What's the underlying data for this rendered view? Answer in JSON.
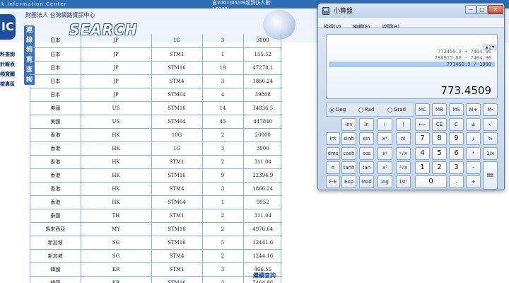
{
  "web": {
    "site_name": "k Information Center",
    "visit_text_1": "自2001/05/09起到訪人數:",
    "visit_text_2": "15941",
    "logo_text": "IC",
    "org_name": "財團法人 台灣網路資訊中心",
    "banner_cn": "連線頻寬查詢",
    "banner_en": "SEARCH",
    "left_nav": [
      "料查詢",
      "計報表",
      "頻寬圖",
      "檢專區"
    ],
    "continue_link": "繼續查詢",
    "table_rows": [
      [
        "日本",
        "JP",
        "1G",
        "3",
        "3000"
      ],
      [
        "日本",
        "JP",
        "STM1",
        "1",
        "155.52"
      ],
      [
        "日本",
        "JP",
        "STM16",
        "19",
        "47278.1"
      ],
      [
        "日本",
        "JP",
        "STM4",
        "3",
        "1866.24"
      ],
      [
        "日本",
        "JP",
        "STM64",
        "4",
        "39808"
      ],
      [
        "美國",
        "US",
        "STM16",
        "14",
        "34836.5"
      ],
      [
        "美國",
        "US",
        "STM64",
        "45",
        "447840"
      ],
      [
        "香港",
        "HK",
        "10G",
        "2",
        "20000"
      ],
      [
        "香港",
        "HK",
        "1G",
        "3",
        "3000"
      ],
      [
        "香港",
        "HK",
        "STM1",
        "2",
        "311.04"
      ],
      [
        "香港",
        "HK",
        "STM16",
        "9",
        "22394.9"
      ],
      [
        "香港",
        "HK",
        "STM4",
        "3",
        "1866.24"
      ],
      [
        "香港",
        "HK",
        "STM64",
        "1",
        "9952"
      ],
      [
        "泰國",
        "TH",
        "STM1",
        "2",
        "311.04"
      ],
      [
        "馬來西亞",
        "MY",
        "STM16",
        "2",
        "4976.64"
      ],
      [
        "新加坡",
        "SG",
        "STM16",
        "5",
        "12441.6"
      ],
      [
        "新加坡",
        "SG",
        "STM4",
        "2",
        "1244.16"
      ],
      [
        "韓國",
        "KR",
        "STM1",
        "3",
        "466.56"
      ],
      [
        "韓國",
        "KR",
        "STM16",
        "3",
        "7464.96"
      ]
    ]
  },
  "calculator": {
    "title": "小算盤",
    "window_buttons": {
      "minimize": "─",
      "maximize": "□",
      "close": "✕"
    },
    "menu": [
      "檢視(V)",
      "編輯(E)",
      "說明(H)"
    ],
    "history_scroll": {
      "up": "▲",
      "down": "▼"
    },
    "history": [
      "773450.9 + 7464.96",
      "780915.86 - 7464.96",
      "773450.9 / 1000"
    ],
    "display_value": "773.4509",
    "angle_modes": [
      {
        "label": "Deg",
        "selected": true
      },
      {
        "label": "Rad",
        "selected": false
      },
      {
        "label": "Grad",
        "selected": false
      }
    ],
    "buttons": {
      "mc": "MC",
      "mr": "MR",
      "ms": "MS",
      "mplus": "M+",
      "mminus": "M-",
      "inv": "Inv",
      "ln": "ln",
      "lparen": "(",
      "rparen": ")",
      "backspace": "⟵",
      "ce": "CE",
      "c": "C",
      "plusminus": "±",
      "sqrt": "√",
      "int": "Int",
      "sinh": "sinh",
      "sin": "sin",
      "x2": "x²",
      "nfact": "n!",
      "d7": "7",
      "d8": "8",
      "d9": "9",
      "divide": "/",
      "percent": "%",
      "dms": "dms",
      "cosh": "cosh",
      "cos": "cos",
      "xy": "xʸ",
      "yroot": "ʸ√x",
      "d4": "4",
      "d5": "5",
      "d6": "6",
      "multiply": "*",
      "recip": "1/x",
      "pi": "π",
      "tanh": "tanh",
      "tan": "tan",
      "x3": "x³",
      "cuberoot": "³√x",
      "d1": "1",
      "d2": "2",
      "d3": "3",
      "minus": "-",
      "equals": "=",
      "fe": "F-E",
      "exp": "Exp",
      "mod": "Mod",
      "log": "log",
      "tenx": "10ˣ",
      "d0": "0",
      "dot": ".",
      "plus": "+"
    }
  }
}
